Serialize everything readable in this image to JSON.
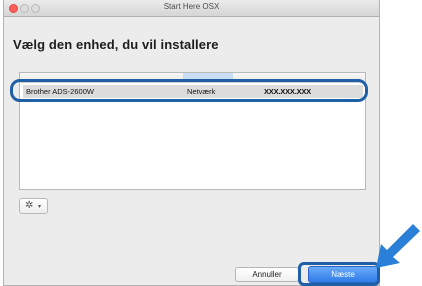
{
  "window": {
    "title": "Start Here OSX"
  },
  "heading": "Vælg den enhed, du vil installere",
  "device_list": {
    "rows": [
      {
        "name": "Brother ADS-2600W",
        "type": "Netværk",
        "address": "XXX.XXX.XXX"
      }
    ]
  },
  "actions": {
    "gear_glyph": "✲",
    "gear_caret": "▾",
    "cancel_label": "Annuller",
    "next_label": "Næste"
  },
  "colors": {
    "highlight_outline": "#1f5fa6",
    "primary_button": "#2f7be7",
    "callout_arrow": "#2a7fd6"
  },
  "icons": [
    "gear-icon",
    "chevron-down-icon",
    "callout-arrow-icon"
  ]
}
